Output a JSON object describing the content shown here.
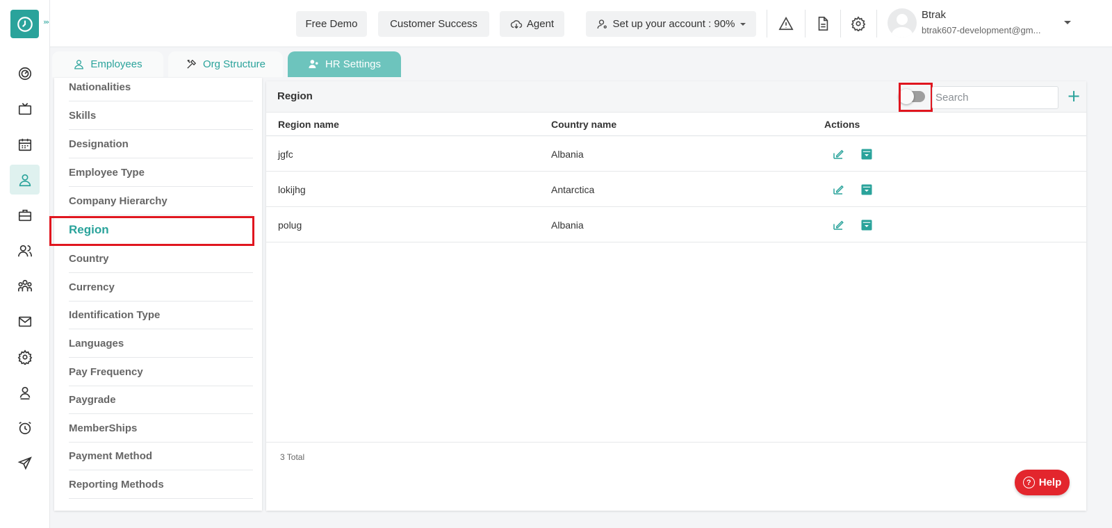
{
  "header": {
    "free_demo": "Free Demo",
    "customer_success": "Customer Success",
    "agent": "Agent",
    "setup": "Set up your account : 90%",
    "user_name": "Btrak",
    "user_email": "btrak607-development@gm..."
  },
  "tabs": [
    {
      "label": "Employees",
      "icon": "user-icon"
    },
    {
      "label": "Org Structure",
      "icon": "tools-icon"
    },
    {
      "label": "HR Settings",
      "icon": "users-gear-icon"
    }
  ],
  "active_tab": "HR Settings",
  "settings_menu": [
    "Nationalities",
    "Skills",
    "Designation",
    "Employee Type",
    "Company Hierarchy",
    "Region",
    "Country",
    "Currency",
    "Identification Type",
    "Languages",
    "Pay Frequency",
    "Paygrade",
    "MemberShips",
    "Payment Method",
    "Reporting Methods"
  ],
  "active_menu": "Region",
  "panel": {
    "title": "Region",
    "search_placeholder": "Search",
    "add_label": "+",
    "archived_toggle_on": false,
    "columns": [
      "Region name",
      "Country name",
      "Actions"
    ],
    "rows": [
      {
        "region": "jgfc",
        "country": "Albania"
      },
      {
        "region": "lokijhg",
        "country": "Antarctica"
      },
      {
        "region": "polug",
        "country": "Albania"
      }
    ],
    "total": "3 Total"
  },
  "help": {
    "icon": "?",
    "label": "Help"
  },
  "colors": {
    "accent": "#2aa39b",
    "highlight": "#e0161f",
    "help": "#e3262d"
  },
  "rail_icons": [
    "dashboard-icon",
    "tv-icon",
    "calendar-icon",
    "user-icon",
    "briefcase-icon",
    "people-icon",
    "team-icon",
    "mail-icon",
    "settings-icon",
    "profile-icon",
    "alarm-icon",
    "send-icon"
  ]
}
